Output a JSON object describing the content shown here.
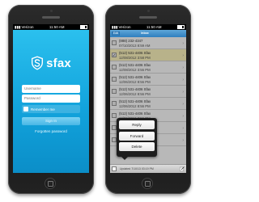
{
  "left_phone": {
    "status_bar": {
      "carrier": "Verizon",
      "time": "11:50 AM"
    },
    "logo": {
      "text": "sfax",
      "icon": "shield-s-icon"
    },
    "login": {
      "username_placeholder": "Username",
      "password_placeholder": "Password",
      "remember_label": "Remember me",
      "sign_in_label": "Sign In",
      "forgot_label": "Forgotten password"
    },
    "colors": {
      "background": "#1aa8df",
      "accent": "#ffffff"
    }
  },
  "right_phone": {
    "status_bar": {
      "carrier": "Verizon",
      "time": "11:50 AM"
    },
    "nav": {
      "edit_label": "Edit",
      "title": "Inbox"
    },
    "faxes": [
      {
        "from": "(888) 232-4347",
        "date": "07/10/2013 8:59 AM",
        "checked": false,
        "selected": false
      },
      {
        "from": "(512) 531-4406 Sfax",
        "date": "12/08/2012 3:58 PM",
        "checked": true,
        "selected": true
      },
      {
        "from": "(512) 531-4406 Sfax",
        "date": "12/08/2012 3:56 PM",
        "checked": false,
        "selected": false
      },
      {
        "from": "(512) 531-4406 Sfax",
        "date": "12/06/2012 8:56 PM",
        "checked": false,
        "selected": false
      },
      {
        "from": "(512) 531-4406 Sfax",
        "date": "12/06/2012 8:56 PM",
        "checked": false,
        "selected": false
      },
      {
        "from": "(512) 531-4406 Sfax",
        "date": "12/06/2012 8:56 PM",
        "checked": false,
        "selected": false
      },
      {
        "from": "(512) 531-4406 Sfax",
        "date": "12/06/2012 8:56 PM",
        "checked": false,
        "selected": false
      },
      {
        "from": "(512) 531-4406 Sfax",
        "date": "12/06/2012 8:56 PM",
        "checked": false,
        "selected": false
      },
      {
        "from": "(512) 531-4406 Sfax",
        "date": "12/06/2012 8:56 PM",
        "checked": false,
        "selected": false
      }
    ],
    "menu": {
      "reply_label": "Reply",
      "forward_label": "Forward",
      "delete_label": "Delete"
    },
    "toolbar": {
      "status": "Updated 7/10/13 03:19 PM",
      "compose_icon": "compose-icon"
    },
    "colors": {
      "selected_row": "#fff7bf",
      "nav": "#3b87c3"
    }
  }
}
